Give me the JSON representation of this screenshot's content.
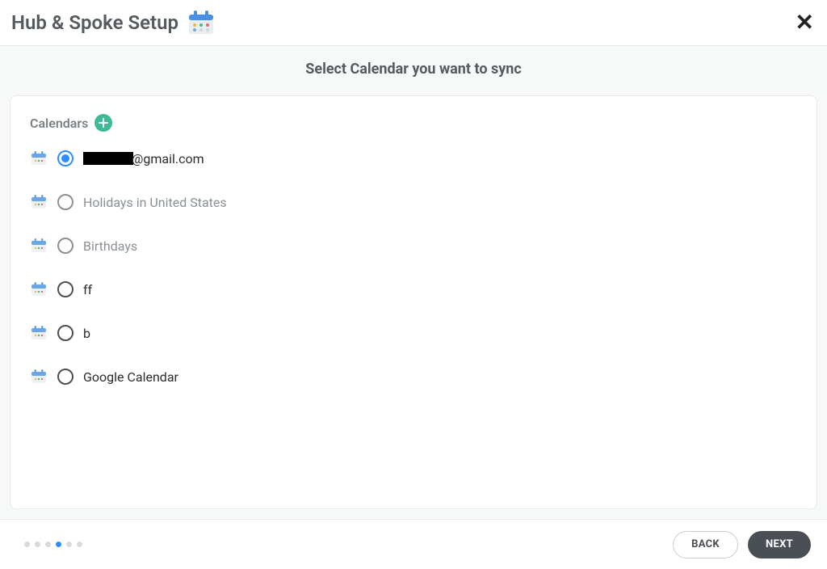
{
  "header": {
    "title": "Hub & Spoke Setup"
  },
  "subtitle": "Select Calendar you want to sync",
  "sectionLabel": "Calendars",
  "calendars": [
    {
      "name": "@gmail.com",
      "redacted": true,
      "selected": true,
      "disabled": false
    },
    {
      "name": "Holidays in United States",
      "redacted": false,
      "selected": false,
      "disabled": true
    },
    {
      "name": "Birthdays",
      "redacted": false,
      "selected": false,
      "disabled": true
    },
    {
      "name": "ff",
      "redacted": false,
      "selected": false,
      "disabled": false
    },
    {
      "name": "b",
      "redacted": false,
      "selected": false,
      "disabled": false
    },
    {
      "name": "Google Calendar",
      "redacted": false,
      "selected": false,
      "disabled": false
    }
  ],
  "buttons": {
    "back": "BACK",
    "next": "NEXT"
  },
  "progress": {
    "total": 6,
    "current": 3
  }
}
